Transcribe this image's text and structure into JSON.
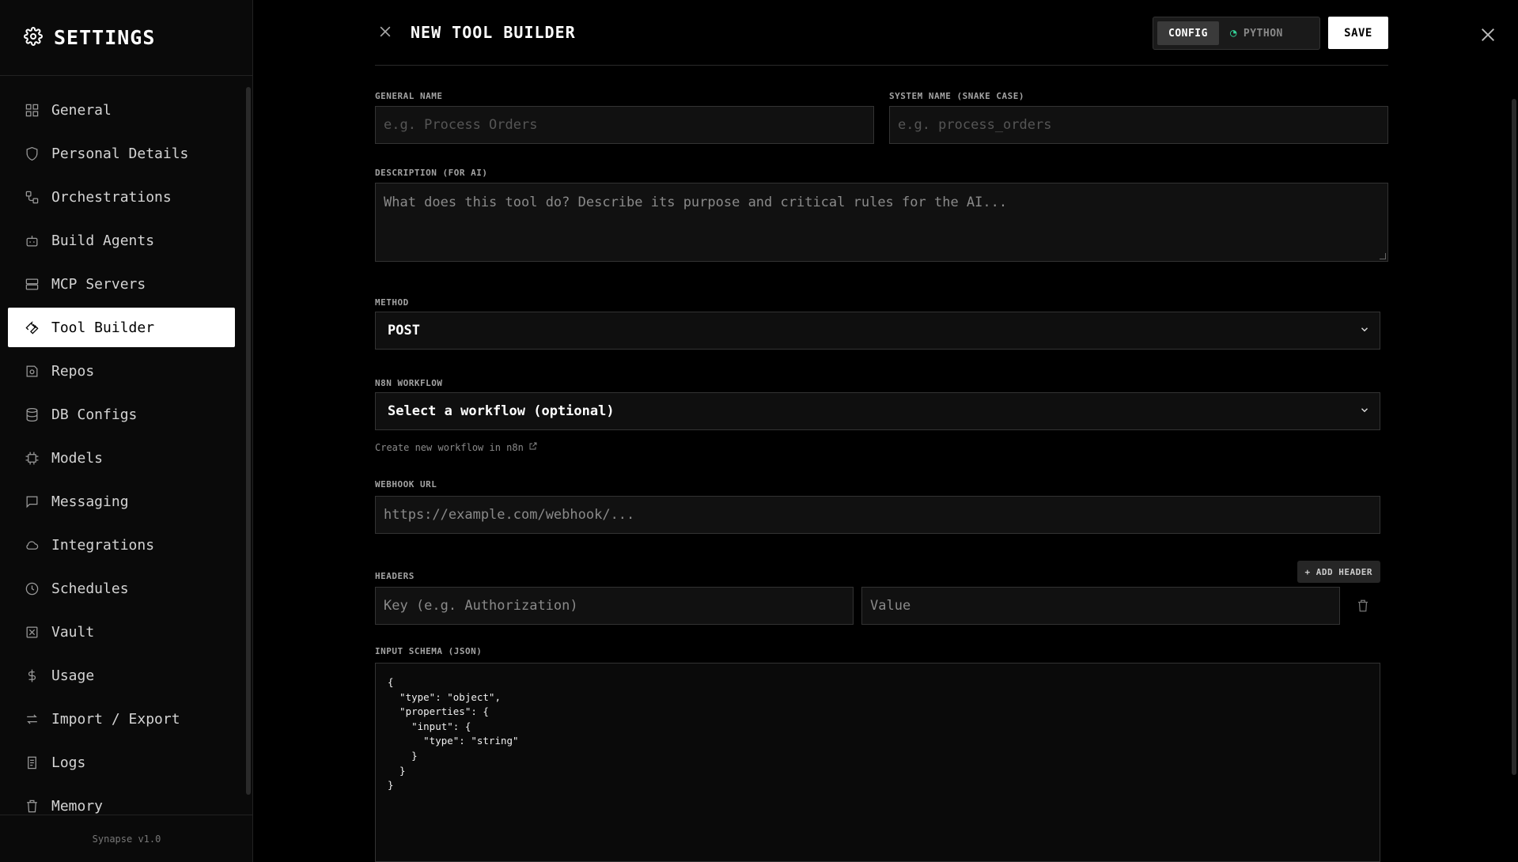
{
  "sidebar": {
    "title": "SETTINGS",
    "items": [
      {
        "label": "General",
        "icon": "grid-icon"
      },
      {
        "label": "Personal Details",
        "icon": "shield-icon"
      },
      {
        "label": "Orchestrations",
        "icon": "workflow-icon"
      },
      {
        "label": "Build Agents",
        "icon": "bot-icon"
      },
      {
        "label": "MCP Servers",
        "icon": "server-icon"
      },
      {
        "label": "Tool Builder",
        "icon": "wrench-icon",
        "active": true
      },
      {
        "label": "Repos",
        "icon": "repo-icon"
      },
      {
        "label": "DB Configs",
        "icon": "database-icon"
      },
      {
        "label": "Models",
        "icon": "chip-icon"
      },
      {
        "label": "Messaging",
        "icon": "message-icon"
      },
      {
        "label": "Integrations",
        "icon": "cloud-icon"
      },
      {
        "label": "Schedules",
        "icon": "clock-icon"
      },
      {
        "label": "Vault",
        "icon": "vault-icon"
      },
      {
        "label": "Usage",
        "icon": "dollar-icon"
      },
      {
        "label": "Import / Export",
        "icon": "arrows-icon"
      },
      {
        "label": "Logs",
        "icon": "logs-icon"
      },
      {
        "label": "Memory",
        "icon": "trash-icon"
      }
    ],
    "footer": "Synapse v1.0"
  },
  "header": {
    "title": "NEW TOOL BUILDER",
    "toggle": {
      "config": "CONFIG",
      "python": "PYTHON"
    },
    "save": "SAVE"
  },
  "form": {
    "general_name": {
      "label": "GENERAL NAME",
      "placeholder": "e.g. Process Orders"
    },
    "system_name": {
      "label": "SYSTEM NAME (SNAKE CASE)",
      "placeholder": "e.g. process_orders"
    },
    "description": {
      "label": "DESCRIPTION (FOR AI)",
      "placeholder": "What does this tool do? Describe its purpose and critical rules for the AI..."
    },
    "method": {
      "label": "METHOD",
      "value": "POST"
    },
    "workflow": {
      "label": "N8N WORKFLOW",
      "value": "Select a workflow (optional)",
      "hint": "Create new workflow in n8n"
    },
    "webhook": {
      "label": "WEBHOOK URL",
      "placeholder": "https://example.com/webhook/..."
    },
    "headers": {
      "label": "HEADERS",
      "add": "+ ADD HEADER",
      "key_placeholder": "Key (e.g. Authorization)",
      "value_placeholder": "Value"
    },
    "schema": {
      "label": "INPUT SCHEMA (JSON)",
      "code": "{\n  \"type\": \"object\",\n  \"properties\": {\n    \"input\": {\n      \"type\": \"string\"\n    }\n  }\n}"
    }
  }
}
